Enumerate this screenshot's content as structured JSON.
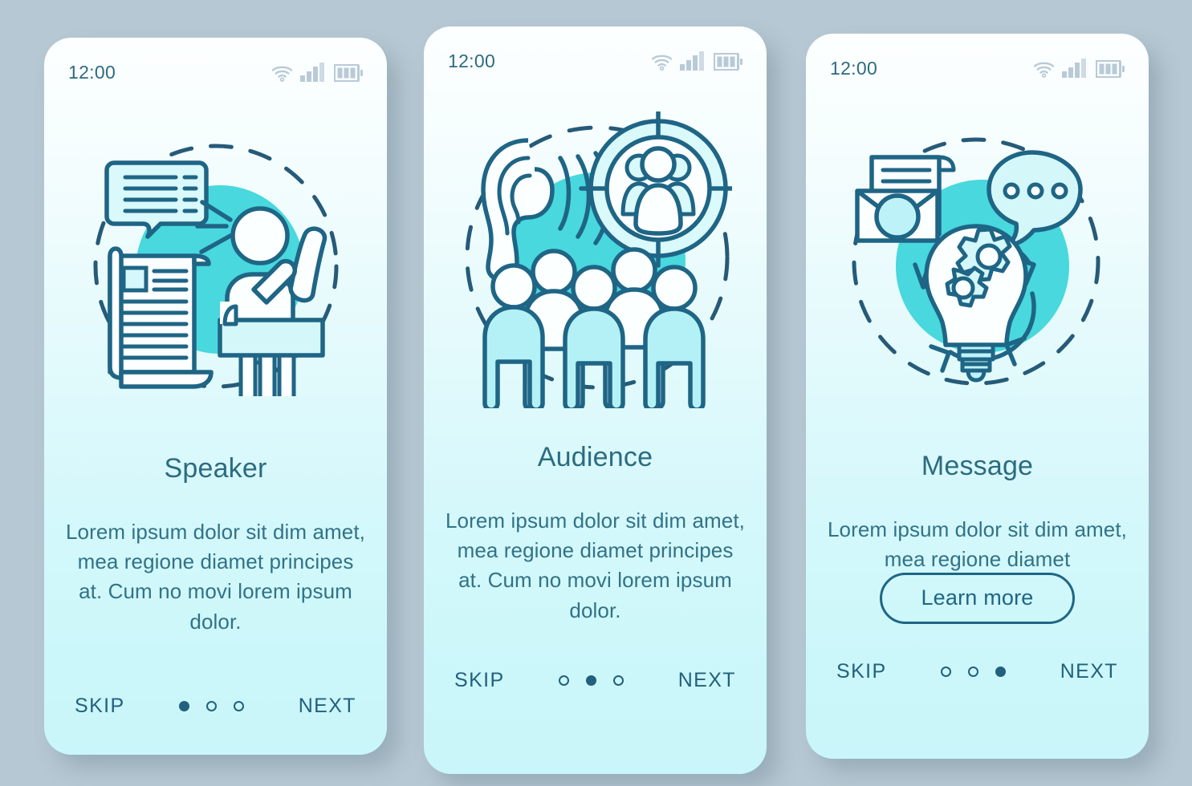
{
  "theme": {
    "page_background": "#b6c8d3",
    "card_gradient_top": "#fdffff",
    "card_gradient_bottom": "#c9f6fa",
    "accent_turquoise": "#48d8de",
    "outline_navy": "#1f6585",
    "title_color": "#2c6b80",
    "body_color": "#327287",
    "status_icon_color": "#b9cad7"
  },
  "screens": [
    {
      "status": {
        "time": "12:00",
        "icons": [
          "wifi-icon",
          "signal-icon",
          "battery-icon"
        ]
      },
      "illustration": {
        "name": "speaker-illustration",
        "elements": [
          "speech-bubble-icon",
          "scroll-document-icon",
          "speaker-at-podium-icon",
          "microphone-icon",
          "raised-arm-icon",
          "turquoise-circle",
          "dashed-circle"
        ]
      },
      "title": "Speaker",
      "body": "Lorem ipsum dolor sit dim amet, mea regione diamet principes at. Cum no movi lorem ipsum dolor.",
      "cta": null,
      "footer": {
        "skip_label": "SKIP",
        "next_label": "NEXT",
        "dots_total": 3,
        "dot_active_index": 0
      }
    },
    {
      "status": {
        "time": "12:00",
        "icons": [
          "wifi-icon",
          "signal-icon",
          "battery-icon"
        ]
      },
      "illustration": {
        "name": "audience-illustration",
        "elements": [
          "ear-icon",
          "sound-waves-icon",
          "target-crosshair-icon",
          "people-group-icon",
          "crowd-of-five-icon",
          "turquoise-circle",
          "dashed-circle"
        ]
      },
      "title": "Audience",
      "body": "Lorem ipsum dolor sit dim amet, mea regione diamet principes at. Cum no movi lorem ipsum dolor.",
      "cta": null,
      "footer": {
        "skip_label": "SKIP",
        "next_label": "NEXT",
        "dots_total": 3,
        "dot_active_index": 1
      }
    },
    {
      "status": {
        "time": "12:00",
        "icons": [
          "wifi-icon",
          "signal-icon",
          "battery-icon"
        ]
      },
      "illustration": {
        "name": "message-illustration",
        "elements": [
          "envelope-with-letter-icon",
          "speech-bubble-ellipsis-icon",
          "lightbulb-with-gears-icon",
          "circular-arrows-icon",
          "turquoise-circle",
          "dashed-circle"
        ]
      },
      "title": "Message",
      "body": "Lorem ipsum dolor sit dim amet, mea regione diamet",
      "cta": "Learn more",
      "footer": {
        "skip_label": "SKIP",
        "next_label": "NEXT",
        "dots_total": 3,
        "dot_active_index": 2
      }
    }
  ]
}
